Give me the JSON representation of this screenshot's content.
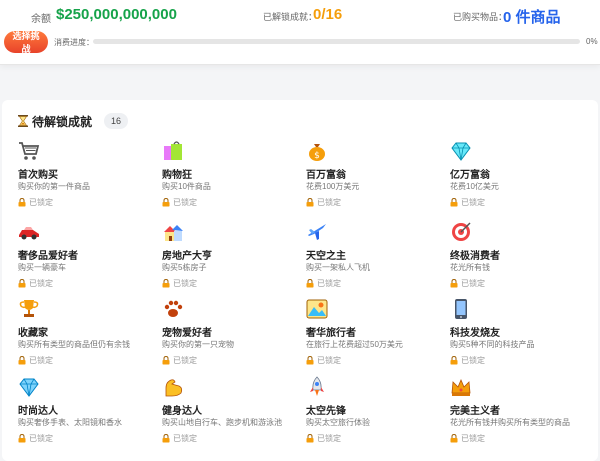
{
  "header": {
    "balance_label": "余额",
    "balance_value": "$250,000,000,000",
    "unlocked_label": "已解锁成就：",
    "unlocked_value": "0/16",
    "owned_label": "已购买物品：",
    "owned_value": "0 件商品",
    "challenge_button": "选择挑战",
    "progress_label": "消费进度：",
    "progress_fraction": 0,
    "progress_text": "0%"
  },
  "section": {
    "title": "待解锁成就",
    "count": "16",
    "icon": "hourglass-icon"
  },
  "achievements": [
    {
      "title": "首次购买",
      "desc": "购买你的第一件商品",
      "status": "已锁定",
      "icon": "shopping-cart-icon"
    },
    {
      "title": "购物狂",
      "desc": "购买10件商品",
      "status": "已锁定",
      "icon": "shopping-bags-icon"
    },
    {
      "title": "百万富翁",
      "desc": "花费100万美元",
      "status": "已锁定",
      "icon": "money-bag-icon"
    },
    {
      "title": "亿万富翁",
      "desc": "花费10亿美元",
      "status": "已锁定",
      "icon": "gem-icon"
    },
    {
      "title": "奢侈品爱好者",
      "desc": "购买一辆豪车",
      "status": "已锁定",
      "icon": "race-car-icon"
    },
    {
      "title": "房地产大亨",
      "desc": "购买5栋房子",
      "status": "已锁定",
      "icon": "houses-icon"
    },
    {
      "title": "天空之主",
      "desc": "购买一架私人飞机",
      "status": "已锁定",
      "icon": "airplane-icon"
    },
    {
      "title": "终极消费者",
      "desc": "花光所有钱",
      "status": "已锁定",
      "icon": "target-icon"
    },
    {
      "title": "收藏家",
      "desc": "购买所有类型的商品但仍有余钱",
      "status": "已锁定",
      "icon": "trophy-icon"
    },
    {
      "title": "宠物爱好者",
      "desc": "购买你的第一只宠物",
      "status": "已锁定",
      "icon": "paw-icon"
    },
    {
      "title": "奢华旅行者",
      "desc": "在旅行上花费超过50万美元",
      "status": "已锁定",
      "icon": "travel-photo-icon"
    },
    {
      "title": "科技发烧友",
      "desc": "购买5种不同的科技产品",
      "status": "已锁定",
      "icon": "phone-icon"
    },
    {
      "title": "时尚达人",
      "desc": "购买奢侈手表、太阳镜和香水",
      "status": "已锁定",
      "icon": "diamond-icon"
    },
    {
      "title": "健身达人",
      "desc": "购买山地自行车、跑步机和游泳池",
      "status": "已锁定",
      "icon": "flexed-arm-icon"
    },
    {
      "title": "太空先锋",
      "desc": "购买太空旅行体验",
      "status": "已锁定",
      "icon": "rocket-icon"
    },
    {
      "title": "完美主义者",
      "desc": "花光所有钱并购买所有类型的商品",
      "status": "已锁定",
      "icon": "crown-icon"
    }
  ]
}
